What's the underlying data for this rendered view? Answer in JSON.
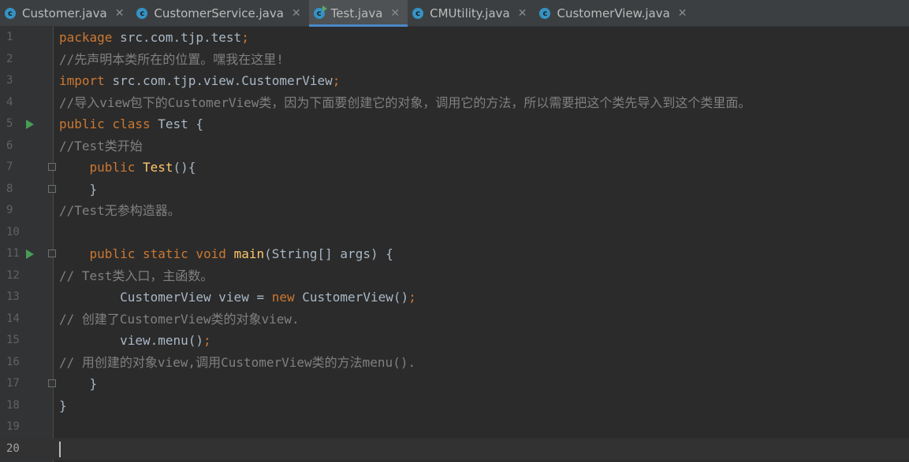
{
  "tabs": [
    {
      "label": "Customer.java",
      "icon": "java-class-icon",
      "active": false
    },
    {
      "label": "CustomerService.java",
      "icon": "java-class-icon",
      "active": false
    },
    {
      "label": "Test.java",
      "icon": "java-runnable-class-icon",
      "active": true
    },
    {
      "label": "CMUtility.java",
      "icon": "java-class-icon",
      "active": false
    },
    {
      "label": "CustomerView.java",
      "icon": "java-class-icon",
      "active": false
    }
  ],
  "tab_icon_letter": "c",
  "close_glyph": "✕",
  "editor": {
    "current_line": 20,
    "lines": [
      {
        "num": "1",
        "parts": [
          [
            "kw",
            "package "
          ],
          [
            "tx",
            "src.com.tjp.test"
          ],
          [
            "semi",
            ";"
          ]
        ]
      },
      {
        "num": "2",
        "parts": [
          [
            "cm",
            "//先声明本类所在的位置。嘿我在这里!"
          ]
        ]
      },
      {
        "num": "3",
        "parts": [
          [
            "kw",
            "import "
          ],
          [
            "tx",
            "src.com.tjp.view.CustomerView"
          ],
          [
            "semi",
            ";"
          ]
        ]
      },
      {
        "num": "4",
        "parts": [
          [
            "cm",
            "//导入view包下的CustomerView类，因为下面要创建它的对象，调用它的方法，所以需要把这个类先导入到这个类里面。"
          ]
        ]
      },
      {
        "num": "5",
        "parts": [
          [
            "kw",
            "public class "
          ],
          [
            "tx",
            "Test {"
          ]
        ],
        "run": true
      },
      {
        "num": "6",
        "parts": [
          [
            "cm",
            "//Test类开始"
          ]
        ]
      },
      {
        "num": "7",
        "parts": [
          [
            "tx",
            "    "
          ],
          [
            "kw",
            "public "
          ],
          [
            "fn",
            "Test"
          ],
          [
            "tx",
            "(){"
          ]
        ],
        "fold": true
      },
      {
        "num": "8",
        "parts": [
          [
            "tx",
            "    }"
          ]
        ],
        "fold": true
      },
      {
        "num": "9",
        "parts": [
          [
            "cm",
            "//Test无参构造器。"
          ]
        ]
      },
      {
        "num": "10",
        "parts": []
      },
      {
        "num": "11",
        "parts": [
          [
            "tx",
            "    "
          ],
          [
            "kw",
            "public static void "
          ],
          [
            "fn",
            "main"
          ],
          [
            "tx",
            "(String[] args) {"
          ]
        ],
        "run": true,
        "fold": true
      },
      {
        "num": "12",
        "parts": [
          [
            "cm",
            "// Test类入口，主函数。"
          ]
        ]
      },
      {
        "num": "13",
        "parts": [
          [
            "tx",
            "        CustomerView view = "
          ],
          [
            "kw",
            "new "
          ],
          [
            "tx",
            "CustomerView()"
          ],
          [
            "semi",
            ";"
          ]
        ]
      },
      {
        "num": "14",
        "parts": [
          [
            "cm",
            "// 创建了CustomerView类的对象view."
          ]
        ]
      },
      {
        "num": "15",
        "parts": [
          [
            "tx",
            "        view.menu()"
          ],
          [
            "semi",
            ";"
          ]
        ]
      },
      {
        "num": "16",
        "parts": [
          [
            "cm",
            "// 用创建的对象view,调用CustomerView类的方法menu()."
          ]
        ]
      },
      {
        "num": "17",
        "parts": [
          [
            "tx",
            "    }"
          ]
        ],
        "fold": true
      },
      {
        "num": "18",
        "parts": [
          [
            "tx",
            "}"
          ]
        ]
      },
      {
        "num": "19",
        "parts": []
      },
      {
        "num": "20",
        "parts": []
      }
    ]
  },
  "colors": {
    "background": "#2b2b2b",
    "keyword": "#cc7832",
    "comment": "#808080",
    "function": "#ffc66d",
    "text": "#a9b7c6",
    "tab_accent": "#4a88c7",
    "run_icon": "#499c54"
  }
}
